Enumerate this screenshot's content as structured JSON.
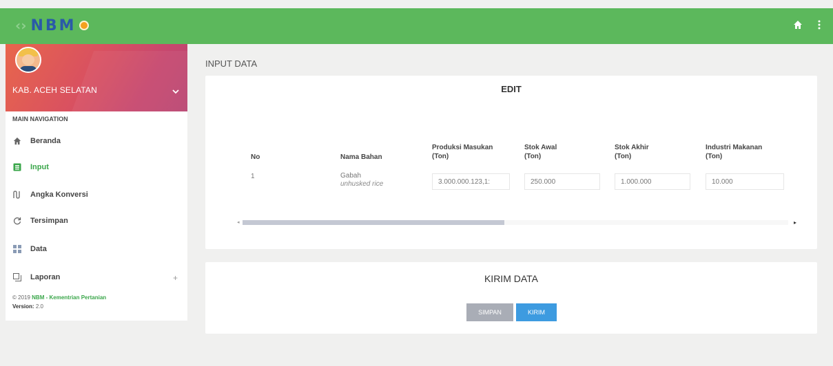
{
  "header": {
    "logo_text": "NBM",
    "colors": {
      "topbar": "#5cb85c",
      "active": "#3aa64a",
      "kirim": "#3d9be0",
      "simpan": "#a9adb6"
    },
    "icons": [
      "home-icon",
      "more-vert-icon"
    ]
  },
  "sidebar": {
    "user_name": "KAB. ACEH SELATAN",
    "nav_header": "MAIN NAVIGATION",
    "items": [
      {
        "label": "Beranda",
        "icon": "home-icon"
      },
      {
        "label": "Input",
        "icon": "form-icon",
        "active": true
      },
      {
        "label": "Angka Konversi",
        "icon": "conversion-icon"
      },
      {
        "label": "Tersimpan",
        "icon": "refresh-icon"
      },
      {
        "label": "Data",
        "icon": "grid-icon"
      },
      {
        "label": "Laporan",
        "icon": "copy-icon"
      }
    ],
    "expand_symbol": "+",
    "footer_prefix": "© 2019",
    "footer_brand": "NBM - Kementrian Pertanian",
    "version_label": "Version:",
    "version_value": "2.0"
  },
  "main": {
    "page_title": "INPUT DATA",
    "edit_card": {
      "title": "EDIT",
      "columns": [
        "No",
        "Nama Bahan",
        "Produksi Masukan\n(Ton)",
        "Stok Awal\n(Ton)",
        "Stok Akhir\n(Ton)",
        "Industri Makanan\n(Ton)"
      ],
      "rows": [
        {
          "no": "1",
          "nama": "Gabah",
          "nama_sub": "unhusked rice",
          "produksi": "3.000.000.123,1:",
          "stok_awal": "250.000",
          "stok_akhir": "1.000.000",
          "industri": "10.000"
        }
      ]
    },
    "kirim_card": {
      "title": "KIRIM DATA",
      "simpan_label": "SIMPAN",
      "kirim_label": "KIRIM"
    }
  }
}
